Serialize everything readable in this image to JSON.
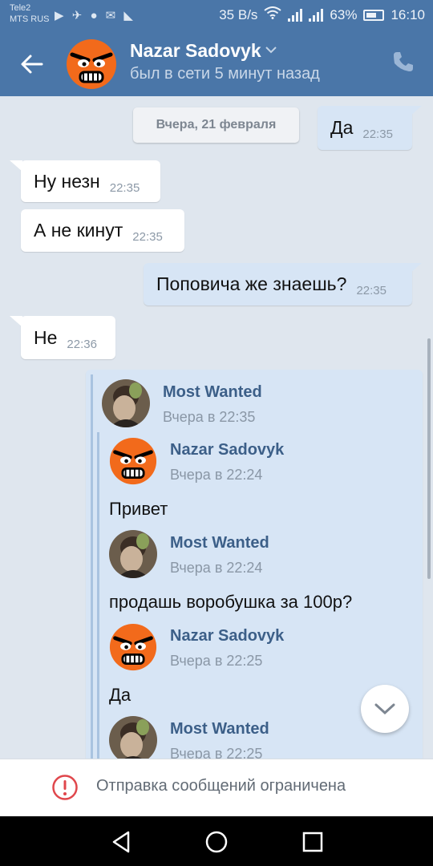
{
  "status_bar": {
    "carrier_1": "Tele2",
    "carrier_2": "MTS RUS",
    "speed": "35 B/s",
    "battery": "63%",
    "time": "16:10"
  },
  "header": {
    "contact_name": "Nazar Sadovyk",
    "status": "был в сети 5 минут назад",
    "accent_color": "#4a76a8"
  },
  "chat": {
    "date_separator": "Вчера, 21 февраля",
    "messages": [
      {
        "direction": "out",
        "text": "Да",
        "time": "22:35"
      },
      {
        "direction": "in",
        "text": "Ну незн",
        "time": "22:35"
      },
      {
        "direction": "in",
        "text": "А не кинут",
        "time": "22:35"
      },
      {
        "direction": "out",
        "text": "Поповича же знаешь?",
        "time": "22:35"
      },
      {
        "direction": "in",
        "text": "Не",
        "time": "22:36"
      }
    ],
    "forwarded": {
      "author": "Most Wanted",
      "date": "Вчера в 22:35",
      "items": [
        {
          "author": "Nazar Sadovyk",
          "date": "Вчера в 22:24",
          "text": "Привет"
        },
        {
          "author": "Most Wanted",
          "date": "Вчера в 22:24",
          "text": "продашь воробушка за 100р?"
        },
        {
          "author": "Nazar Sadovyk",
          "date": "Вчера в 22:25",
          "text": "Да"
        },
        {
          "author": "Most Wanted",
          "date": "Вчера в 22:25",
          "text": ""
        }
      ]
    }
  },
  "restriction": {
    "text": "Отправка сообщений ограничена",
    "icon": "exclamation-circle-icon",
    "icon_color": "#e0474c"
  },
  "navigation": {
    "back": "triangle-back-icon",
    "home": "circle-home-icon",
    "recents": "square-recents-icon"
  }
}
